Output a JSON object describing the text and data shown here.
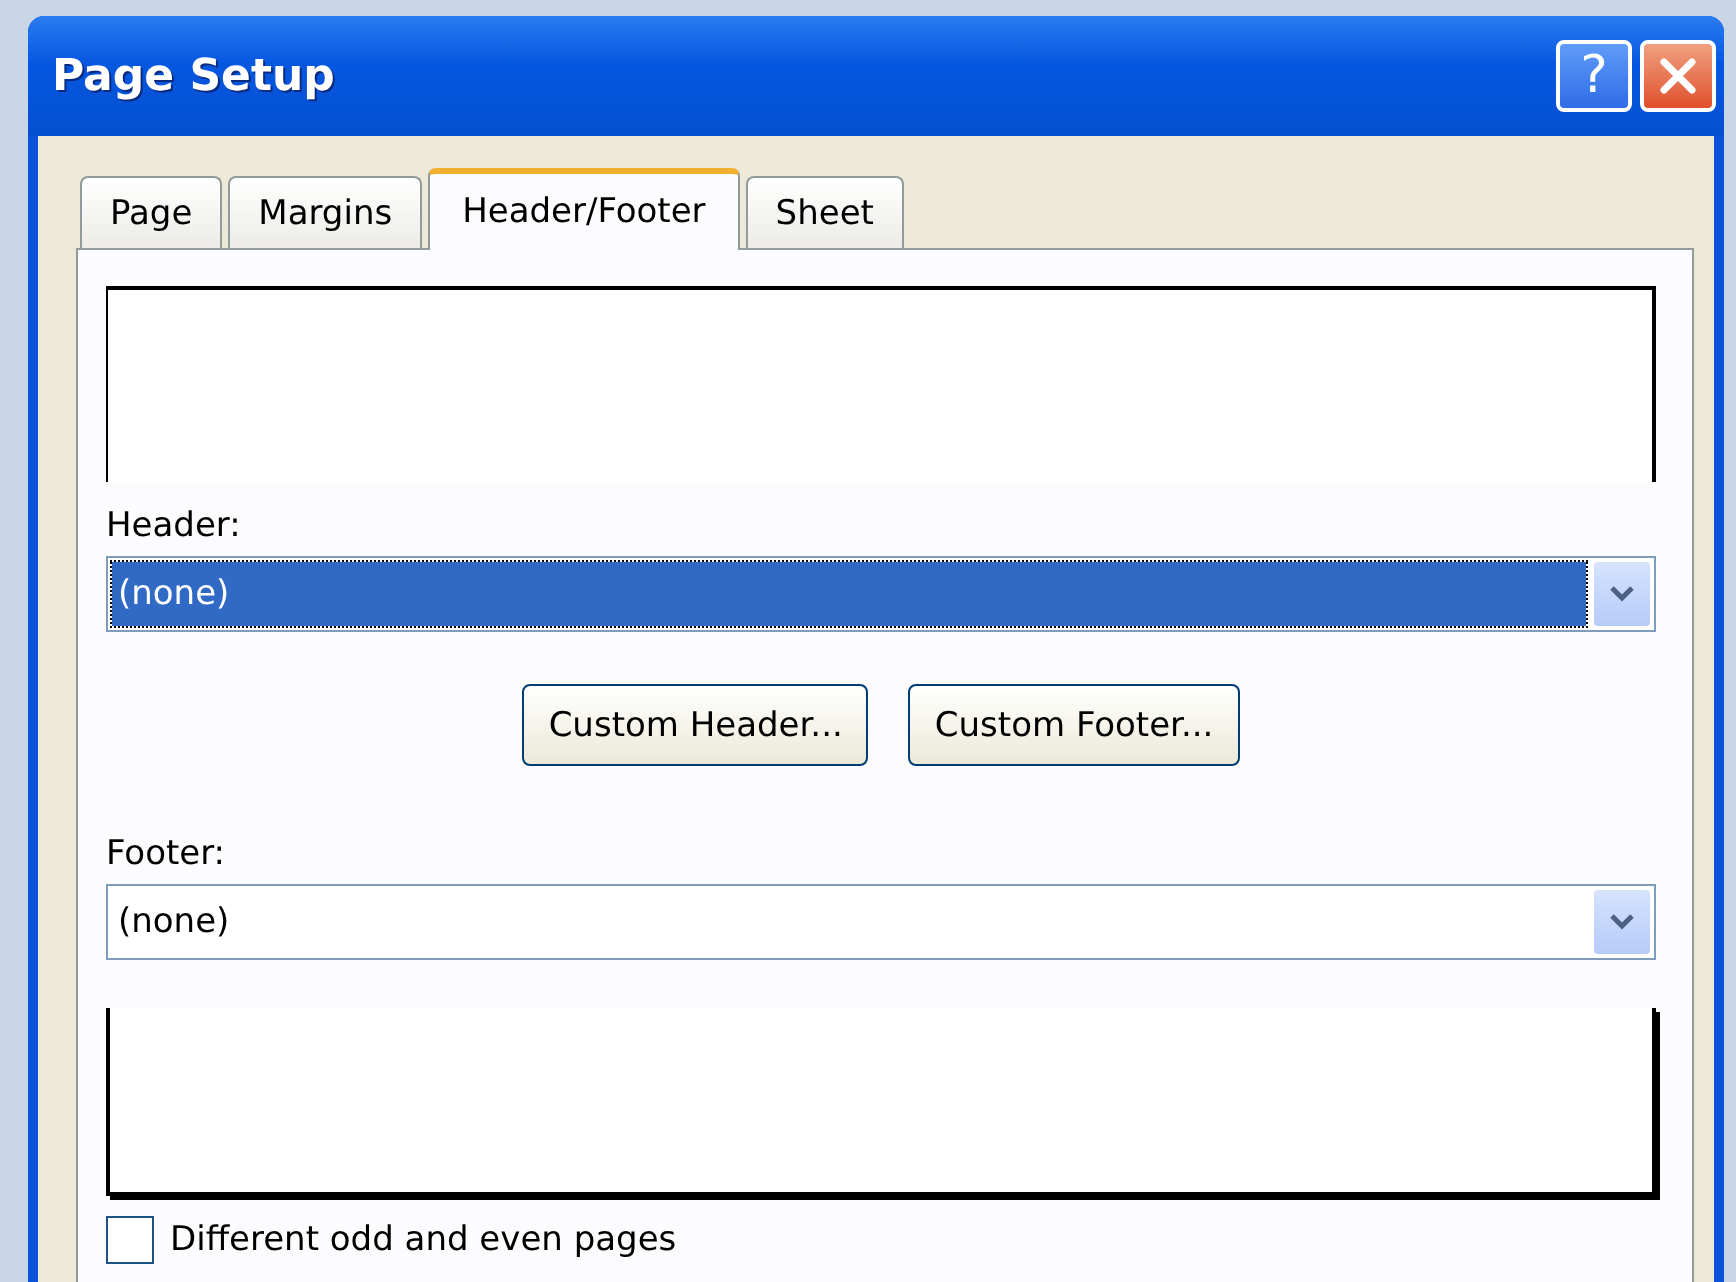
{
  "window": {
    "title": "Page Setup",
    "help": "?"
  },
  "tabs": [
    {
      "label": "Page",
      "selected": false
    },
    {
      "label": "Margins",
      "selected": false
    },
    {
      "label": "Header/Footer",
      "selected": true
    },
    {
      "label": "Sheet",
      "selected": false
    }
  ],
  "header": {
    "label": "Header:",
    "value": "(none)",
    "focused": true
  },
  "buttons": [
    "Custom Header...",
    "Custom Footer..."
  ],
  "footer": {
    "label": "Footer:",
    "value": "(none)",
    "focused": false
  },
  "options": [
    {
      "label": "Different odd and even pages",
      "checked": false
    }
  ]
}
